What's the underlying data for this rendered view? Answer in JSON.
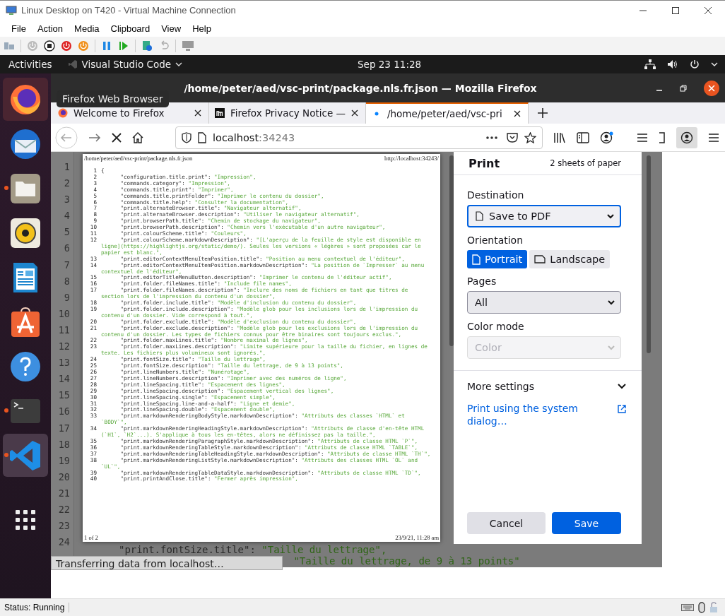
{
  "vm_window": {
    "title": "Linux Desktop on T420 - Virtual Machine Connection",
    "menu": [
      "File",
      "Action",
      "Media",
      "Clipboard",
      "View",
      "Help"
    ],
    "status": "Status: Running"
  },
  "topbar": {
    "activities": "Activities",
    "app": "Visual Studio Code",
    "datetime": "Sep 23  11:28"
  },
  "dock": [
    {
      "kind": "firefox",
      "hovered": true,
      "selected": false,
      "running": false
    },
    {
      "kind": "mail",
      "hovered": false,
      "selected": false,
      "running": false
    },
    {
      "kind": "files",
      "hovered": false,
      "selected": false,
      "running": true
    },
    {
      "kind": "music",
      "hovered": false,
      "selected": false,
      "running": false
    },
    {
      "kind": "writer",
      "hovered": false,
      "selected": false,
      "running": false
    },
    {
      "kind": "software",
      "hovered": false,
      "selected": false,
      "running": false
    },
    {
      "kind": "help",
      "hovered": false,
      "selected": false,
      "running": false
    },
    {
      "kind": "terminal",
      "hovered": false,
      "selected": false,
      "running": true
    },
    {
      "kind": "vscode",
      "hovered": false,
      "selected": true,
      "running": true
    },
    {
      "kind": "apps",
      "hovered": false,
      "selected": false,
      "running": false
    }
  ],
  "tooltip": "Firefox Web Browser",
  "firefox": {
    "title": "/home/peter/aed/vsc-print/package.nls.fr.json — Mozilla Firefox",
    "tabs": [
      {
        "kind": "firefox",
        "label": "Welcome to Firefox",
        "selected": false
      },
      {
        "kind": "m",
        "label": "Firefox Privacy Notice —",
        "selected": false
      },
      {
        "kind": "dot",
        "label": "/home/peter/aed/vsc-pri",
        "selected": true
      }
    ],
    "url_host": "localhost",
    "url_port": ":34243"
  },
  "line_numbers": [
    "1",
    "2",
    "3",
    "4",
    "5",
    "6",
    "7",
    "8",
    "9",
    "10",
    "11",
    "12",
    "13",
    "14",
    "15",
    "16",
    "17",
    "18",
    "19",
    "20",
    "21",
    "22",
    "23",
    "24"
  ],
  "preview": {
    "header_left": "/home/peter/aed/vsc-print/package.nls.fr.json",
    "header_right": "http://localhost:34243/",
    "lines": [
      {
        "n": "1",
        "key": "{"
      },
      {
        "n": "2",
        "key": "\t\"configuration.title.print\":",
        "value": "\"Impression\","
      },
      {
        "n": "3",
        "key": "\t\"commands.category\":",
        "value": "\"Impression\","
      },
      {
        "n": "4",
        "key": "\t\"commands.title.print\":",
        "value": "\"Imprimer\","
      },
      {
        "n": "5",
        "key": "\t\"commands.title.printFolder\":",
        "value": "\"Imprimer le contenu du dossier\","
      },
      {
        "n": "6",
        "key": "\t\"commands.title.help\":",
        "value": "\"Consulter la documentation\","
      },
      {
        "n": "7",
        "key": "\t\"print.alternateBrowser.title\":",
        "value": "\"Navigateur alternatif\","
      },
      {
        "n": "8",
        "key": "\t\"print.alternateBrowser.description\":",
        "value": "\"Utiliser le navigateur alternatif\","
      },
      {
        "n": "9",
        "key": "\t\"print.browserPath.title\":",
        "value": "\"Chemin de stockage du navigateur\","
      },
      {
        "n": "10",
        "key": "\t\"print.browserPath.description\":",
        "value": "\"Chemin vers l'exécutable d'un autre navigateur\","
      },
      {
        "n": "11",
        "key": "\t\"print.colourScheme.title\":",
        "value": "\"Couleurs\","
      },
      {
        "n": "12",
        "key": "\t\"print.colourScheme.markdownDescription\":",
        "value": "\"[L'aperçu de la feuille de style est disponible en ligne](https://highlightjs.org/static/demo/). Seules les versions « légères » sont proposées car le papier est blanc.\","
      },
      {
        "n": "13",
        "key": "\t\"print.editorContextMenuItemPosition.title\":",
        "value": "\"Position au menu contextuel de l'éditeur\","
      },
      {
        "n": "14",
        "key": "\t\"print.editorContextMenuItemPosition.markdownDescription\":",
        "value": "\"La position de `Impresser` au menu contextuel de l'éditeur\","
      },
      {
        "n": "15",
        "key": "\t\"print.editorTitleMenuButton.description\":",
        "value": "\"Imprimer le contenu de l'éditeur actif\","
      },
      {
        "n": "16",
        "key": "\t\"print.folder.fileNames.title\":",
        "value": "\"Include file names\","
      },
      {
        "n": "17",
        "key": "\t\"print.folder.fileNames.description\":",
        "value": "\"Inclure des noms de fichiers en tant que titres de section lors de l'impression du contenu d'un dossier\","
      },
      {
        "n": "18",
        "key": "\t\"print.folder.include.title\":",
        "value": "\"Modèle d'inclusion du contenu du dossier\","
      },
      {
        "n": "19",
        "key": "\t\"print.folder.include.description\":",
        "value": "\"Modèle glob pour les inclusions lors de l'impression du contenu d'un dossier. Vide correspond à tout.\","
      },
      {
        "n": "20",
        "key": "\t\"print.folder.exclude.title\":",
        "value": "\"Modèle d'exclusion du contenu du dossier\","
      },
      {
        "n": "21",
        "key": "\t\"print.folder.exclude.description\":",
        "value": "\"Modèle glob pour les exclusions lors de l'impression du contenu d'un dossier. Les types de fichiers connus pour être binaires sont toujours exclus.\","
      },
      {
        "n": "22",
        "key": "\t\"print.folder.maxLines.title\":",
        "value": "\"Nombre maximal de lignes\","
      },
      {
        "n": "23",
        "key": "\t\"print.folder.maxLines.description\":",
        "value": "\"Limite supérieure pour la taille du fichier, en lignes de texte. Les fichiers plus volumineux sont ignorés.\","
      },
      {
        "n": "24",
        "key": "\t\"print.fontSize.title\":",
        "value": "\"Taille du lettrage\","
      },
      {
        "n": "25",
        "key": "\t\"print.fontSize.description\":",
        "value": "\"Taille du lettrage, de 9 à 13 points\","
      },
      {
        "n": "26",
        "key": "\t\"print.lineNumbers.title\":",
        "value": "\"Numérotage\","
      },
      {
        "n": "27",
        "key": "\t\"print.lineNumbers.description\":",
        "value": "\"Imprimer avec des numéros de ligne\","
      },
      {
        "n": "28",
        "key": "\t\"print.lineSpacing.title\":",
        "value": "\"Espacement des lignes\","
      },
      {
        "n": "29",
        "key": "\t\"print.lineSpacing.description\":",
        "value": "\"Espacement vertical des lignes\","
      },
      {
        "n": "30",
        "key": "\t\"print.lineSpacing.single\":",
        "value": "\"Espacement simple\","
      },
      {
        "n": "31",
        "key": "\t\"print.lineSpacing.line-and-a-half\":",
        "value": "\"Ligne et demie\","
      },
      {
        "n": "32",
        "key": "\t\"print.lineSpacing.double\":",
        "value": "\"Espacement double\","
      },
      {
        "n": "33",
        "key": "\t\"print.markdownRenderingBodyStyle.markdownDescription\":",
        "value": "\"Attributs des classes `HTML` et `BODY`\","
      },
      {
        "n": "34",
        "key": "\t\"print.markdownRenderingHeadingStyle.markdownDescription\":",
        "value": "\"Attributs de classe d'en-tête HTML (`H1`, `H2`...). S'applique à tous les en-têtes, alors ne définissez pas la taille.\","
      },
      {
        "n": "35",
        "key": "\t\"print.markdownRenderingParagraphStyle.markdownDescription\":",
        "value": "\"Attributs de classe HTML `P`\","
      },
      {
        "n": "36",
        "key": "\t\"print.markdownRenderingTableStyle.markdownDescription\":",
        "value": "\"Attributs de classe HTML `TABLE`\","
      },
      {
        "n": "37",
        "key": "\t\"print.markdownRenderingTableHeadingStyle.markdownDescription\":",
        "value": "\"Attributs de classe HTML `TH`\","
      },
      {
        "n": "38",
        "key": "\t\"print.markdownRenderingListStyle.markdownDescription\":",
        "value": "\"Attributs des classes HTML `OL` and `UL`\","
      },
      {
        "n": "39",
        "key": "\t\"print.markdownRenderingTableDataStyle.markdownDescription\":",
        "value": "\"Attributs de classe HTML `TD`\","
      },
      {
        "n": "40",
        "key": "\t\"print.printAndClose.title\":",
        "value": "\"Fermer après impression\","
      }
    ],
    "footer_left": "1 of 2",
    "footer_right": "23/9/21, 11:28 am"
  },
  "print": {
    "title": "Print",
    "sheets": "2 sheets of paper",
    "destination": {
      "label": "Destination",
      "value": "Save to PDF",
      "focused": true
    },
    "orientation": {
      "label": "Orientation",
      "options": [
        {
          "kind": "portrait",
          "label": "Portrait",
          "selected": true
        },
        {
          "kind": "landscape",
          "label": "Landscape",
          "selected": false
        }
      ]
    },
    "pages": {
      "label": "Pages",
      "value": "All",
      "focused": false
    },
    "color_mode": {
      "label": "Color mode",
      "value": "Color",
      "disabled": true
    },
    "more_settings": "More settings",
    "system_dialog": "Print using the system dialog…",
    "buttons": [
      {
        "kind": "secondary",
        "label": "Cancel"
      },
      {
        "kind": "primary",
        "label": "Save"
      }
    ]
  },
  "editor_lines": [
    {
      "kind": "key-value",
      "key": "\"print.fontSize.title\":",
      "value": "\"Taille du lettrage\","
    },
    {
      "kind": "continuation",
      "value": "\"Taille du lettrage, de 9 à 13 points\""
    }
  ],
  "status_overlay": "Transferring data from localhost…"
}
